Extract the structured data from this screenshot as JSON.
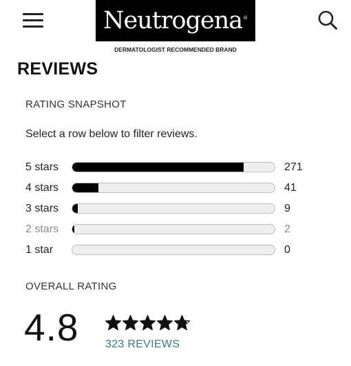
{
  "header": {
    "menu_icon": "hamburger-menu-icon",
    "brand_name": "Neutrogena",
    "brand_mark": "®",
    "tagline": "DERMATOLOGIST RECOMMENDED BRAND",
    "search_icon": "search-icon"
  },
  "reviews": {
    "title": "REVIEWS",
    "snapshot_heading": "RATING SNAPSHOT",
    "filter_instruction": "Select a row below to filter reviews.",
    "rows": [
      {
        "label": "5 stars",
        "count": "271",
        "fraction": 0.84,
        "muted": false
      },
      {
        "label": "4 stars",
        "count": "41",
        "fraction": 0.127,
        "muted": false
      },
      {
        "label": "3 stars",
        "count": "9",
        "fraction": 0.028,
        "muted": false
      },
      {
        "label": "2 stars",
        "count": "2",
        "fraction": 0.006,
        "muted": true
      },
      {
        "label": "1 star",
        "count": "0",
        "fraction": 0,
        "muted": false
      }
    ],
    "overall_heading": "OVERALL RATING",
    "overall_score": "4.8",
    "star_rating": 4.8,
    "reviews_link": "323 REVIEWS"
  },
  "colors": {
    "bar_fill": "#000000",
    "bar_track": "#eeeeee",
    "link": "#2b7a9e",
    "logo_background": "#000000"
  }
}
